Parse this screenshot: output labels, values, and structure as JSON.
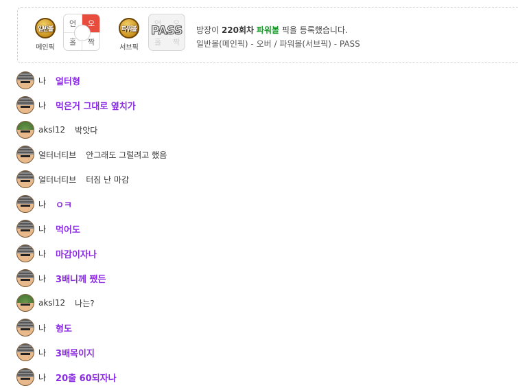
{
  "pick": {
    "main_badge": "일반볼",
    "main_caption": "메인픽",
    "main_grid": [
      "언",
      "오",
      "홀",
      "짝"
    ],
    "sub_badge": "파워볼",
    "sub_caption": "서브픽",
    "sub_grid": [
      "언",
      "오",
      "홀",
      "짝"
    ],
    "sub_pass": "PASS",
    "announce_prefix": "방장이",
    "announce_round": "220회차",
    "announce_power": "파워볼",
    "announce_suffix": "픽을 등록했습니다.",
    "summary": "일반볼(메인픽) - 오버 / 파워볼(서브픽) - PASS"
  },
  "chat": [
    {
      "nick": "나",
      "text": "얼터형",
      "mine": true,
      "avatar": "gray"
    },
    {
      "nick": "나",
      "text": "먹은거 그대로 옆치가",
      "mine": true,
      "avatar": "gray"
    },
    {
      "nick": "aksl12",
      "text": "박앗다",
      "mine": false,
      "avatar": "green"
    },
    {
      "nick": "얼터너티브",
      "text": "안그래도 그럴려고 했음",
      "mine": false,
      "avatar": "gray"
    },
    {
      "nick": "얼터너티브",
      "text": "터짐 난 마감",
      "mine": false,
      "avatar": "gray"
    },
    {
      "nick": "나",
      "text": "ㅇㅋ",
      "mine": true,
      "avatar": "gray"
    },
    {
      "nick": "나",
      "text": "먹어도",
      "mine": true,
      "avatar": "gray"
    },
    {
      "nick": "나",
      "text": "마감이자나",
      "mine": true,
      "avatar": "gray"
    },
    {
      "nick": "나",
      "text": "3배니께 쨌든",
      "mine": true,
      "avatar": "gray"
    },
    {
      "nick": "aksl12",
      "text": "나는?",
      "mine": false,
      "avatar": "green"
    },
    {
      "nick": "나",
      "text": "형도",
      "mine": true,
      "avatar": "gray"
    },
    {
      "nick": "나",
      "text": "3배목이지",
      "mine": true,
      "avatar": "gray"
    },
    {
      "nick": "나",
      "text": "20출 60되자나",
      "mine": true,
      "avatar": "gray"
    }
  ],
  "colors": {
    "mine_text": "#8b2be2",
    "highlight": "#e74c3c",
    "power_green": "#1a9a2a"
  }
}
